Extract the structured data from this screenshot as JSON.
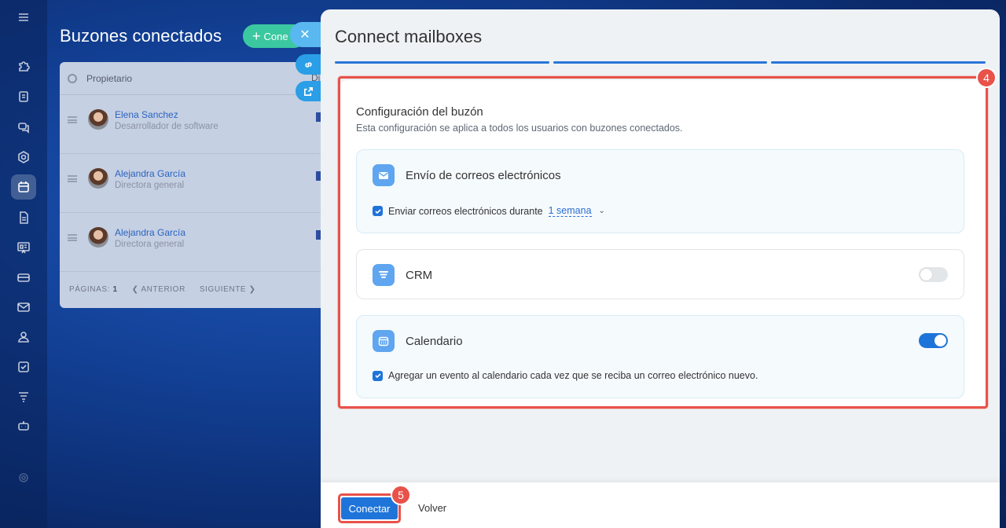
{
  "sidebar": {
    "items": [
      {
        "icon": "menu-icon",
        "name": "menu"
      },
      {
        "icon": "puzzle-icon",
        "name": "apps"
      },
      {
        "icon": "document-icon",
        "name": "docs"
      },
      {
        "icon": "chat-icon",
        "name": "chat"
      },
      {
        "icon": "hexagon-icon",
        "name": "hub"
      },
      {
        "icon": "calendar-icon",
        "name": "calendar"
      },
      {
        "icon": "file-icon",
        "name": "files"
      },
      {
        "icon": "board-icon",
        "name": "board"
      },
      {
        "icon": "card-icon",
        "name": "cards"
      },
      {
        "icon": "mail-icon",
        "name": "mail"
      },
      {
        "icon": "users-icon",
        "name": "users"
      },
      {
        "icon": "checkbox-icon",
        "name": "tasks"
      },
      {
        "icon": "filter-icon",
        "name": "funnel"
      },
      {
        "icon": "bot-icon",
        "name": "bot"
      }
    ]
  },
  "background": {
    "title": "Buzones conectados",
    "add_button": "Cone",
    "table_header": "Propietario",
    "col_d_label": "Di",
    "rows": [
      {
        "name": "Elena Sanchez",
        "role": "Desarrollador de software"
      },
      {
        "name": "Alejandra García",
        "role": "Directora general"
      },
      {
        "name": "Alejandra García",
        "role": "Directora general"
      }
    ],
    "pager": {
      "pages_label": "PÁGINAS:",
      "pages_value": "1",
      "prev": "❮ ANTERIOR",
      "next": "SIGUIENTE ❯"
    }
  },
  "slider": {
    "close": "✕",
    "title": "Connect mailboxes",
    "config": {
      "title": "Configuración del buzón",
      "subtitle": "Esta configuración se aplica a todos los usuarios con buzones conectados.",
      "send": {
        "label": "Envío de correos electrónicos",
        "check_text": "Enviar correos electrónicos durante",
        "period": "1 semana",
        "checked": true
      },
      "crm": {
        "label": "CRM",
        "enabled": false
      },
      "calendar": {
        "label": "Calendario",
        "enabled": true,
        "check_text": "Agregar un evento al calendario cada vez que se reciba un correo electrónico nuevo.",
        "checked": true
      }
    },
    "badge_config": "4",
    "badge_connect": "5",
    "footer": {
      "connect": "Conectar",
      "back": "Volver"
    }
  },
  "colors": {
    "accent": "#1f74d9",
    "highlight": "#e8524a",
    "toggle_off": "#e3e6e9"
  }
}
